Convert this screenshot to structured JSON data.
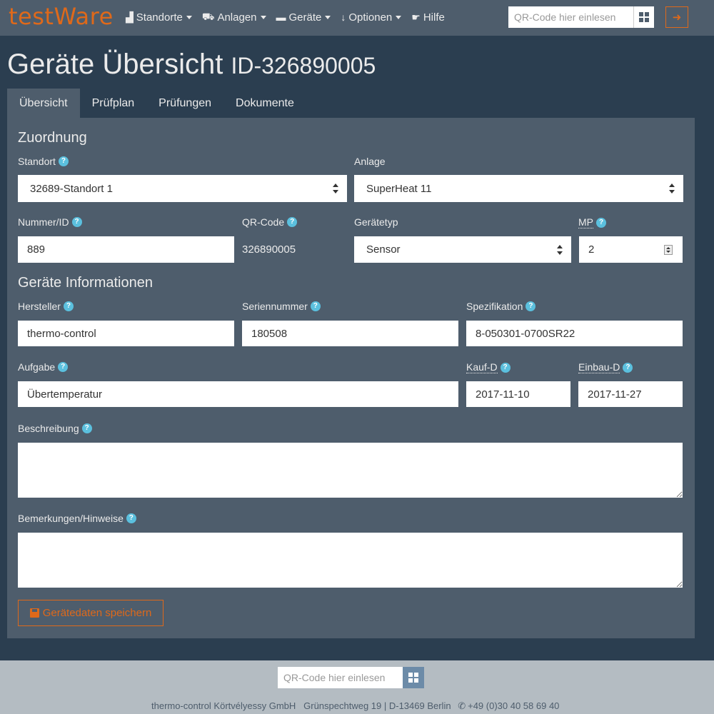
{
  "brand": "testWare",
  "nav": {
    "items": [
      {
        "label": "Standorte",
        "icon": "factory-icon",
        "glyph": "▟",
        "caret": true
      },
      {
        "label": "Anlagen",
        "icon": "car-icon",
        "glyph": "⛟",
        "caret": true
      },
      {
        "label": "Geräte",
        "icon": "tv-icon",
        "glyph": "▬",
        "caret": true
      },
      {
        "label": "Optionen",
        "icon": "arrow-down-icon",
        "glyph": "↓",
        "caret": true
      },
      {
        "label": "Hilfe",
        "icon": "handshake-icon",
        "glyph": "☛",
        "caret": false
      }
    ],
    "qr_placeholder": "QR-Code hier einlesen",
    "logout_icon": "sign-out-icon"
  },
  "page": {
    "title": "Geräte Übersicht",
    "id_label": "ID-326890005"
  },
  "tabs": [
    {
      "label": "Übersicht",
      "active": true
    },
    {
      "label": "Prüfplan",
      "active": false
    },
    {
      "label": "Prüfungen",
      "active": false
    },
    {
      "label": "Dokumente",
      "active": false
    }
  ],
  "zuordnung": {
    "title": "Zuordnung",
    "standort_label": "Standort",
    "standort_value": "32689-Standort 1",
    "anlage_label": "Anlage",
    "anlage_value": "SuperHeat 11",
    "nummer_label": "Nummer/ID",
    "nummer_value": "889",
    "qrcode_label": "QR-Code",
    "qrcode_value": "326890005",
    "geraetetyp_label": "Gerätetyp",
    "geraetetyp_value": "Sensor",
    "mp_label": "MP",
    "mp_value": "2"
  },
  "info": {
    "title": "Geräte Informationen",
    "hersteller_label": "Hersteller",
    "hersteller_value": "thermo-control",
    "seriennummer_label": "Seriennummer",
    "seriennummer_value": "180508",
    "spezifikation_label": "Spezifikation",
    "spezifikation_value": "8-050301-0700SR22",
    "aufgabe_label": "Aufgabe",
    "aufgabe_value": "Übertemperatur",
    "kauf_label": "Kauf-D",
    "kauf_value": "2017-11-10",
    "einbau_label": "Einbau-D",
    "einbau_value": "2017-11-27",
    "beschreibung_label": "Beschreibung",
    "beschreibung_value": "",
    "bemerkungen_label": "Bemerkungen/Hinweise",
    "bemerkungen_value": ""
  },
  "save_label": "Gerätedaten speichern",
  "footer": {
    "qr_placeholder": "QR-Code hier einlesen",
    "company": "thermo-control Körtvélyessy GmbH",
    "address": "Grünspechtweg 19 | D-13469 Berlin",
    "phone": "+49 (0)30 40 58 69 40"
  },
  "colors": {
    "accent": "#df691a",
    "background": "#2b3e50",
    "panel": "#4e5d6c",
    "help": "#5bc0de"
  }
}
